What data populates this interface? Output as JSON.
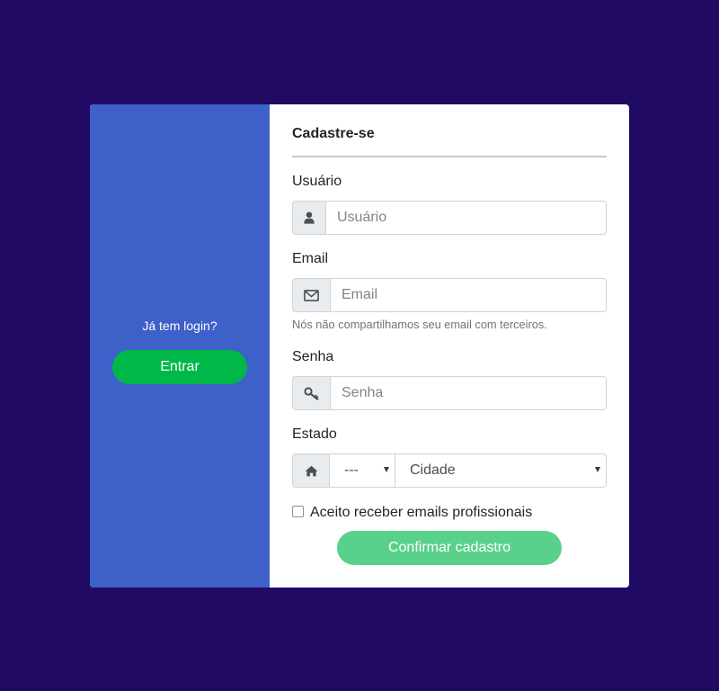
{
  "sidebar": {
    "prompt": "Já tem login?",
    "login_button": "Entrar"
  },
  "form": {
    "title": "Cadastre-se",
    "username": {
      "label": "Usuário",
      "placeholder": "Usuário",
      "icon": "user-icon"
    },
    "email": {
      "label": "Email",
      "placeholder": "Email",
      "icon": "envelope-icon",
      "help": "Nós não compartilhamos seu email com terceiros."
    },
    "password": {
      "label": "Senha",
      "placeholder": "Senha",
      "icon": "key-icon"
    },
    "location": {
      "label": "Estado",
      "icon": "home-icon",
      "state_value": "---",
      "city_value": "Cidade"
    },
    "newsletter": {
      "label": "Aceito receber emails profissionais",
      "checked": false
    },
    "submit_button": "Confirmar cadastro"
  },
  "colors": {
    "background": "#200a63",
    "sidebar": "#3e60c9",
    "login_button": "#00b84a",
    "confirm_button": "#5ad18a"
  }
}
